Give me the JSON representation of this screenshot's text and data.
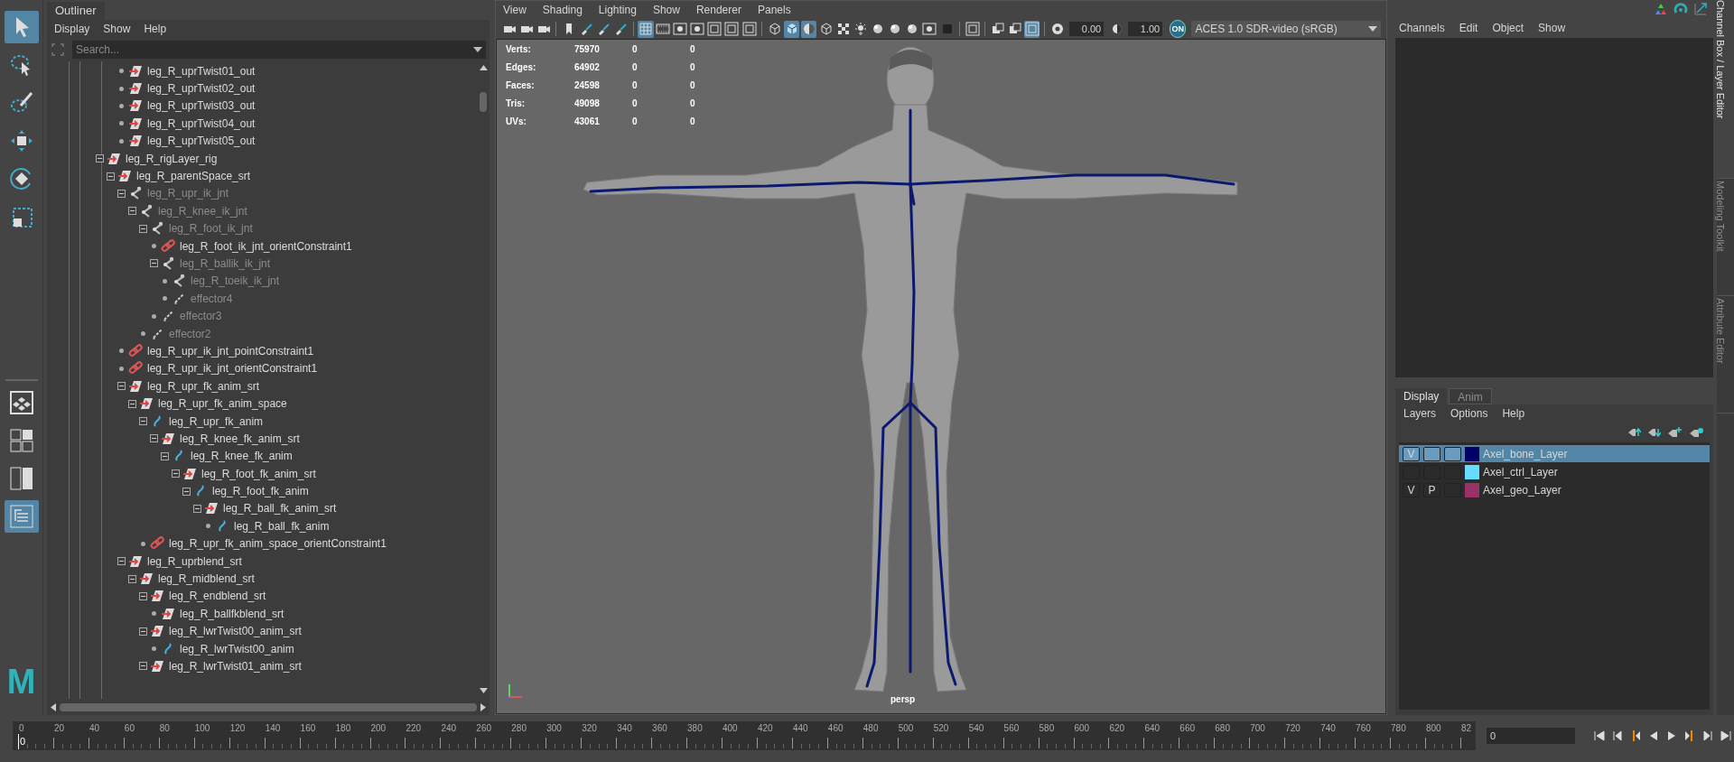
{
  "toolbox": {
    "tools": [
      {
        "kind": "select",
        "selected": true
      },
      {
        "kind": "lasso",
        "selected": false
      },
      {
        "kind": "paint",
        "selected": false
      },
      {
        "kind": "move",
        "selected": false
      },
      {
        "kind": "rotate",
        "selected": false
      },
      {
        "kind": "scale",
        "selected": false
      }
    ],
    "layouts": [
      {
        "kind": "single",
        "selected": false
      },
      {
        "kind": "four",
        "selected": false
      },
      {
        "kind": "two",
        "selected": false
      },
      {
        "kind": "outliner",
        "selected": true
      }
    ],
    "logo": "M"
  },
  "outliner": {
    "tab": "Outliner",
    "menu": [
      "Display",
      "Show",
      "Help"
    ],
    "search": {
      "placeholder": "Search..."
    },
    "tree": [
      {
        "children": [
          {
            "children": [
              {
                "label": "leg_R_uprTwist01_out",
                "kind": "transform",
                "dimmed": false
              },
              {
                "label": "leg_R_uprTwist02_out",
                "kind": "transform",
                "dimmed": false
              },
              {
                "label": "leg_R_uprTwist03_out",
                "kind": "transform",
                "dimmed": false
              },
              {
                "label": "leg_R_uprTwist04_out",
                "kind": "transform",
                "dimmed": false
              },
              {
                "label": "leg_R_uprTwist05_out",
                "kind": "transform",
                "dimmed": false
              }
            ]
          }
        ]
      },
      {
        "label": "leg_R_rigLayer_rig",
        "kind": "transform",
        "dimmed": false,
        "expanded": true,
        "children": [
          {
            "label": "leg_R_parentSpace_srt",
            "kind": "transform",
            "dimmed": false,
            "expanded": true,
            "children": [
              {
                "label": "leg_R_upr_ik_jnt",
                "kind": "joint",
                "dimmed": true,
                "expanded": true,
                "children": [
                  {
                    "label": "leg_R_knee_ik_jnt",
                    "kind": "joint",
                    "dimmed": true,
                    "expanded": true,
                    "children": [
                      {
                        "label": "leg_R_foot_ik_jnt",
                        "kind": "joint",
                        "dimmed": true,
                        "expanded": true,
                        "children": [
                          {
                            "label": "leg_R_foot_ik_jnt_orientConstraint1",
                            "kind": "constraint",
                            "dimmed": false
                          },
                          {
                            "label": "leg_R_ballik_ik_jnt",
                            "kind": "joint",
                            "dimmed": true,
                            "expanded": true,
                            "children": [
                              {
                                "label": "leg_R_toeik_ik_jnt",
                                "kind": "joint",
                                "dimmed": true
                              },
                              {
                                "label": "effector4",
                                "kind": "effector",
                                "dimmed": true
                              }
                            ]
                          },
                          {
                            "label": "effector3",
                            "kind": "effector",
                            "dimmed": true
                          }
                        ]
                      },
                      {
                        "label": "effector2",
                        "kind": "effector",
                        "dimmed": true
                      }
                    ]
                  }
                ]
              },
              {
                "label": "leg_R_upr_ik_jnt_pointConstraint1",
                "kind": "constraint",
                "dimmed": false
              },
              {
                "label": "leg_R_upr_ik_jnt_orientConstraint1",
                "kind": "constraint",
                "dimmed": false
              },
              {
                "label": "leg_R_upr_fk_anim_srt",
                "kind": "transform",
                "dimmed": false,
                "expanded": true,
                "children": [
                  {
                    "label": "leg_R_upr_fk_anim_space",
                    "kind": "transform",
                    "dimmed": false,
                    "expanded": true,
                    "children": [
                      {
                        "label": "leg_R_upr_fk_anim",
                        "kind": "curve",
                        "dimmed": false,
                        "expanded": true,
                        "children": [
                          {
                            "label": "leg_R_knee_fk_anim_srt",
                            "kind": "transform",
                            "dimmed": false,
                            "expanded": true,
                            "children": [
                              {
                                "label": "leg_R_knee_fk_anim",
                                "kind": "curve",
                                "dimmed": false,
                                "expanded": true,
                                "children": [
                                  {
                                    "label": "leg_R_foot_fk_anim_srt",
                                    "kind": "transform",
                                    "dimmed": false,
                                    "expanded": true,
                                    "children": [
                                      {
                                        "label": "leg_R_foot_fk_anim",
                                        "kind": "curve",
                                        "dimmed": false,
                                        "expanded": true,
                                        "children": [
                                          {
                                            "label": "leg_R_ball_fk_anim_srt",
                                            "kind": "transform",
                                            "dimmed": false,
                                            "expanded": true,
                                            "children": [
                                              {
                                                "label": "leg_R_ball_fk_anim",
                                                "kind": "curve",
                                                "dimmed": false
                                              }
                                            ]
                                          }
                                        ]
                                      }
                                    ]
                                  }
                                ]
                              }
                            ]
                          }
                        ]
                      },
                      {
                        "label": "leg_R_upr_fk_anim_space_orientConstraint1",
                        "kind": "constraint",
                        "dimmed": false
                      }
                    ]
                  }
                ]
              },
              {
                "label": "leg_R_uprblend_srt",
                "kind": "transform",
                "dimmed": false,
                "expanded": true,
                "children": [
                  {
                    "label": "leg_R_midblend_srt",
                    "kind": "transform",
                    "dimmed": false,
                    "expanded": true,
                    "children": [
                      {
                        "label": "leg_R_endblend_srt",
                        "kind": "transform",
                        "dimmed": false,
                        "expanded": true,
                        "children": [
                          {
                            "label": "leg_R_ballfkblend_srt",
                            "kind": "transform",
                            "dimmed": false
                          }
                        ]
                      },
                      {
                        "label": "leg_R_lwrTwist00_anim_srt",
                        "kind": "transform",
                        "dimmed": false,
                        "expanded": true,
                        "children": [
                          {
                            "label": "leg_R_lwrTwist00_anim",
                            "kind": "curve",
                            "dimmed": false
                          }
                        ]
                      },
                      {
                        "label": "leg_R_lwrTwist01_anim_srt",
                        "kind": "transform",
                        "dimmed": false,
                        "expanded": true
                      }
                    ]
                  }
                ]
              }
            ]
          }
        ]
      }
    ]
  },
  "viewport": {
    "menu": [
      "View",
      "Shading",
      "Lighting",
      "Show",
      "Renderer",
      "Panels"
    ],
    "toolbar": [
      {
        "kind": "camera",
        "selected": false
      },
      {
        "kind": "camera",
        "selected": false
      },
      {
        "kind": "camera",
        "selected": false
      },
      {
        "kind": "bookmark",
        "selected": false
      },
      {
        "kind": "brush",
        "selected": false
      },
      {
        "kind": "brush",
        "selected": false
      },
      {
        "kind": "brush",
        "selected": false
      },
      {
        "kind": "grid",
        "selected": true
      },
      {
        "kind": "film",
        "selected": false
      },
      {
        "kind": "circle",
        "selected": false
      },
      {
        "kind": "circle",
        "selected": false
      },
      {
        "kind": "frame",
        "selected": false
      },
      {
        "kind": "frame",
        "selected": false
      },
      {
        "kind": "frame",
        "selected": false
      },
      {
        "kind": "wirecube",
        "selected": false
      },
      {
        "kind": "cube",
        "selected": true
      },
      {
        "kind": "halfsphere",
        "selected": true
      },
      {
        "kind": "wirecube",
        "selected": false
      },
      {
        "kind": "checker",
        "selected": false
      },
      {
        "kind": "light",
        "selected": false
      },
      {
        "kind": "sphere",
        "selected": false
      },
      {
        "kind": "sphere",
        "selected": false
      },
      {
        "kind": "sphere",
        "selected": false
      },
      {
        "kind": "circle",
        "selected": false
      },
      {
        "kind": "square",
        "selected": false
      },
      {
        "kind": "frame",
        "selected": false
      },
      {
        "kind": "stack",
        "selected": false
      },
      {
        "kind": "stack",
        "selected": false
      },
      {
        "kind": "frame",
        "selected": true
      },
      {
        "kind": "aperture",
        "selected": false
      }
    ],
    "exposure": "0.00",
    "gamma": "1.00",
    "color_management": "ON",
    "color_space": "ACES 1.0 SDR-video (sRGB)",
    "stats": [
      {
        "label": "Verts:",
        "values": [
          "75970",
          "0",
          "0"
        ]
      },
      {
        "label": "Edges:",
        "values": [
          "64902",
          "0",
          "0"
        ]
      },
      {
        "label": "Faces:",
        "values": [
          "24598",
          "0",
          "0"
        ]
      },
      {
        "label": "Tris:",
        "values": [
          "49098",
          "0",
          "0"
        ]
      },
      {
        "label": "UVs:",
        "values": [
          "43061",
          "0",
          "0"
        ]
      }
    ],
    "camera": "persp"
  },
  "channel_box": {
    "menu": [
      "Channels",
      "Edit",
      "Object",
      "Show"
    ]
  },
  "layer_editor": {
    "tabs": [
      {
        "label": "Display",
        "selected": true
      },
      {
        "label": "Anim",
        "selected": false
      }
    ],
    "menu": [
      "Layers",
      "Options",
      "Help"
    ],
    "layers": [
      {
        "name": "Axel_bone_Layer",
        "visibility": "V",
        "color": "#000066",
        "selected": true
      },
      {
        "name": "Axel_ctrl_Layer",
        "color": "#66ddff",
        "selected": false
      },
      {
        "name": "Axel_geo_Layer",
        "visibility": "V",
        "playback": "P",
        "color": "#993366",
        "selected": false
      }
    ]
  },
  "side_tabs": [
    {
      "label": "Channel Box / Layer Editor",
      "selected": true
    },
    {
      "label": "Modeling Toolkit",
      "selected": false
    },
    {
      "label": "Attribute Editor",
      "selected": false
    }
  ],
  "timeline": {
    "ticks": [
      "0",
      "20",
      "40",
      "60",
      "80",
      "100",
      "120",
      "140",
      "160",
      "180",
      "200",
      "220",
      "240",
      "260",
      "280",
      "300",
      "320",
      "340",
      "360",
      "380",
      "400",
      "420",
      "440",
      "460",
      "480",
      "500",
      "520",
      "540",
      "560",
      "580",
      "600",
      "620",
      "640",
      "660",
      "680",
      "700",
      "720",
      "740",
      "760",
      "780",
      "800",
      "82"
    ],
    "current_frame": "0",
    "level": 0,
    "frame_field": "0"
  }
}
